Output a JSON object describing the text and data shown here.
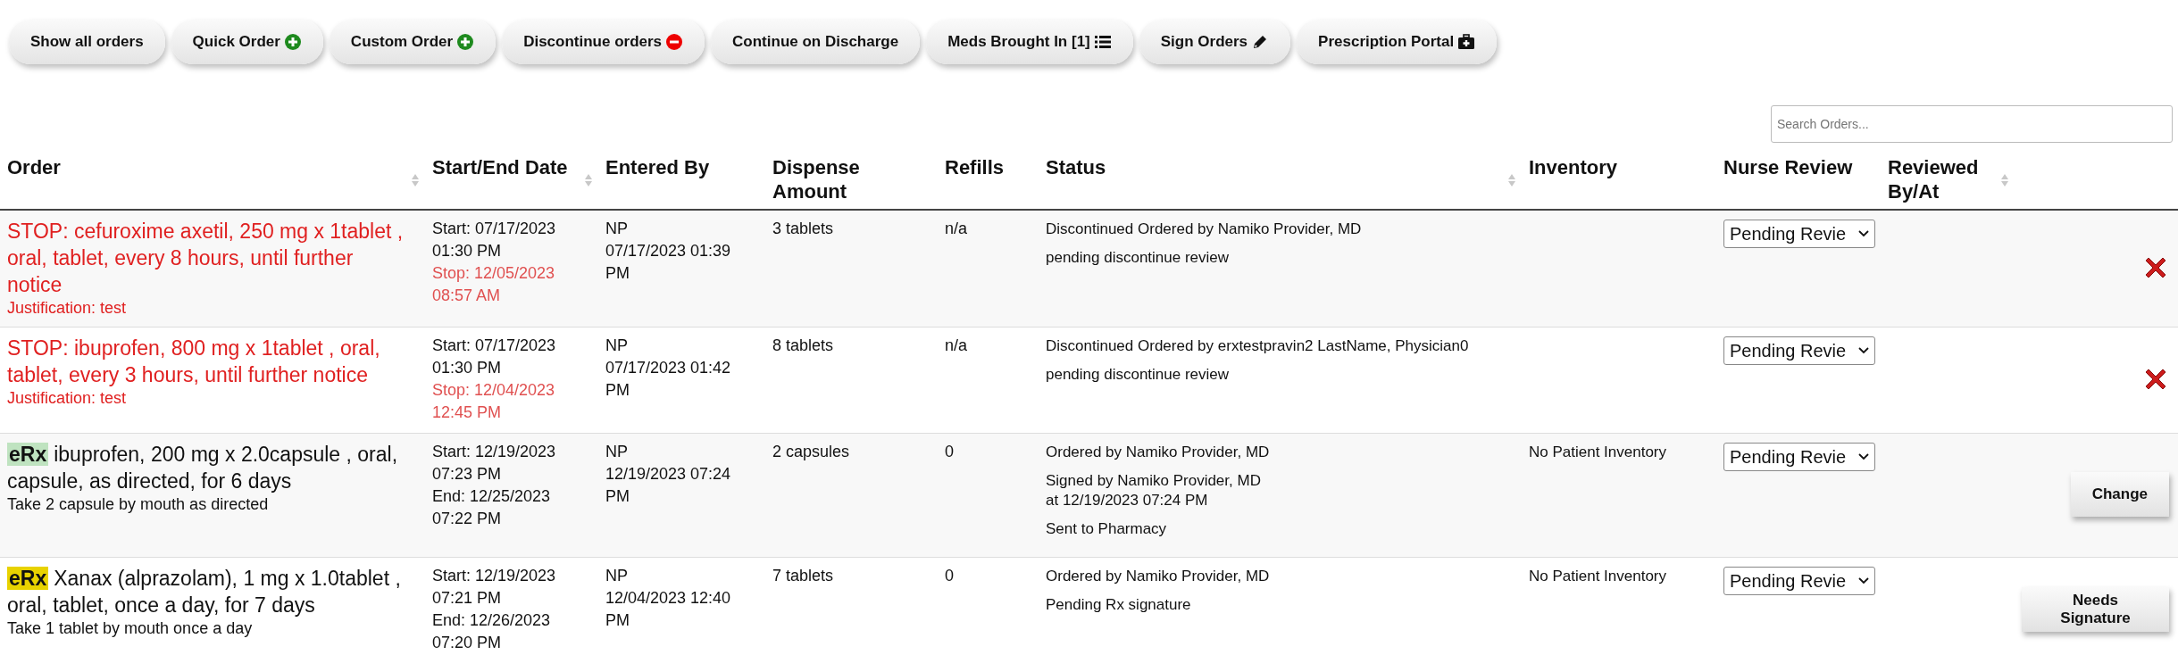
{
  "toolbar": [
    {
      "label": "Show all orders",
      "kind": "plain"
    },
    {
      "label": "Quick Order",
      "kind": "add"
    },
    {
      "label": "Custom Order",
      "kind": "add"
    },
    {
      "label": "Discontinue orders",
      "kind": "remove"
    },
    {
      "label": "Continue on Discharge",
      "kind": "plain"
    },
    {
      "label": "Meds Brought In [1]",
      "kind": "list"
    },
    {
      "label": "Sign Orders",
      "kind": "pencil"
    },
    {
      "label": "Prescription Portal",
      "kind": "medkit"
    }
  ],
  "search": {
    "placeholder": "Search Orders..."
  },
  "table": {
    "columns": [
      {
        "label": "Order",
        "sortable": true
      },
      {
        "label": "Start/End Date",
        "sortable": true
      },
      {
        "label": "Entered By",
        "sortable": false
      },
      {
        "label": "Dispense Amount",
        "sortable": false
      },
      {
        "label": "Refills",
        "sortable": false
      },
      {
        "label": "Status",
        "sortable": true
      },
      {
        "label": "Inventory",
        "sortable": false
      },
      {
        "label": "Nurse Review",
        "sortable": false
      },
      {
        "label": "Reviewed By/At",
        "sortable": true
      }
    ],
    "rows": [
      {
        "discontinued": true,
        "badge": null,
        "order": "STOP: cefuroxime axetil, 250 mg x 1tablet , oral, tablet, every 8 hours, until further notice",
        "note": "Justification: test",
        "dates": [
          {
            "kind": "start",
            "text": "Start: 07/17/2023 01:30 PM"
          },
          {
            "kind": "stop",
            "text": "Stop: 12/05/2023 08:57 AM"
          }
        ],
        "entered_by": "NP",
        "entered_at": "07/17/2023 01:39 PM",
        "dispense": "3 tablets",
        "refills": "n/a",
        "status": [
          [
            "Discontinued Ordered by Namiko Provider, MD"
          ],
          [
            "pending discontinue review"
          ]
        ],
        "inventory": null,
        "nurse_review": "Pending Revie",
        "action": {
          "kind": "delete"
        }
      },
      {
        "discontinued": true,
        "badge": null,
        "order": "STOP: ibuprofen, 800 mg x 1tablet , oral, tablet, every 3 hours, until further notice",
        "note": "Justification: test",
        "dates": [
          {
            "kind": "start",
            "text": "Start: 07/17/2023 01:30 PM"
          },
          {
            "kind": "stop",
            "text": "Stop: 12/04/2023 12:45 PM"
          }
        ],
        "entered_by": "NP",
        "entered_at": "07/17/2023 01:42 PM",
        "dispense": "8 tablets",
        "refills": "n/a",
        "status": [
          [
            "Discontinued Ordered by erxtestpravin2 LastName, Physician0"
          ],
          [
            "pending discontinue review"
          ]
        ],
        "inventory": null,
        "nurse_review": "Pending Revie",
        "action": {
          "kind": "delete"
        }
      },
      {
        "discontinued": false,
        "badge": {
          "label": "eRx",
          "color": "#bfe3c0"
        },
        "order": "ibuprofen, 200 mg x 2.0capsule , oral, capsule, as directed, for 6 days",
        "note": "Take 2 capsule by mouth as directed",
        "dates": [
          {
            "kind": "start",
            "text": "Start: 12/19/2023 07:23 PM"
          },
          {
            "kind": "end",
            "text": "End: 12/25/2023 07:22 PM"
          }
        ],
        "entered_by": "NP",
        "entered_at": "12/19/2023 07:24 PM",
        "dispense": "2 capsules",
        "refills": "0",
        "status": [
          [
            "Ordered by Namiko Provider, MD"
          ],
          [
            "Signed by Namiko Provider, MD",
            "at 12/19/2023 07:24 PM"
          ],
          [
            "Sent to Pharmacy"
          ]
        ],
        "inventory": "No Patient Inventory",
        "nurse_review": "Pending Revie",
        "action": {
          "kind": "button",
          "label": "Change"
        }
      },
      {
        "discontinued": false,
        "badge": {
          "label": "eRx",
          "color": "#e8d200"
        },
        "order": "Xanax (alprazolam), 1 mg x 1.0tablet , oral, tablet, once a day, for 7 days",
        "note": "Take 1 tablet by mouth once a day",
        "dates": [
          {
            "kind": "start",
            "text": "Start: 12/19/2023 07:21 PM"
          },
          {
            "kind": "end",
            "text": "End: 12/26/2023 07:20 PM"
          }
        ],
        "entered_by": "NP",
        "entered_at": "12/04/2023 12:40 PM",
        "dispense": "7 tablets",
        "refills": "0",
        "status": [
          [
            "Ordered by Namiko Provider, MD"
          ],
          [
            "Pending Rx signature"
          ]
        ],
        "inventory": "No Patient Inventory",
        "nurse_review": "Pending Revie",
        "action": {
          "kind": "button",
          "label": "Needs Signature"
        }
      }
    ]
  }
}
